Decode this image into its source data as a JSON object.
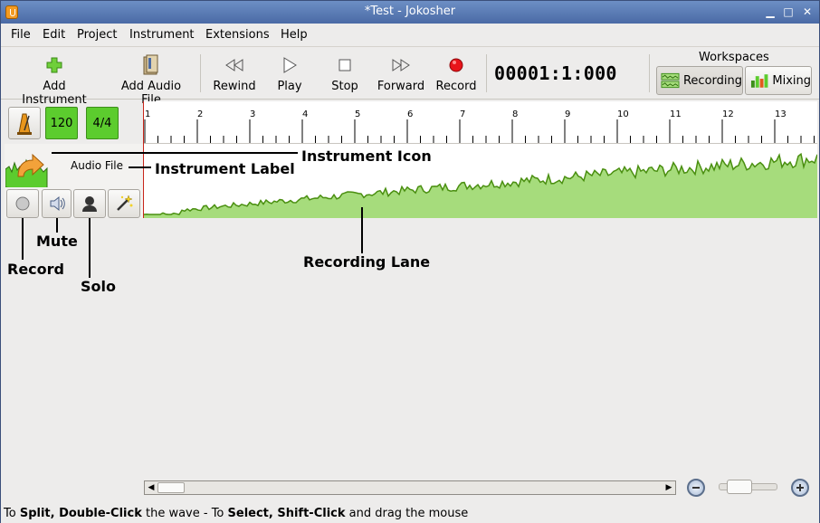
{
  "window": {
    "title": "*Test - Jokosher",
    "min_label": "▁",
    "max_label": "□",
    "close_label": "✕"
  },
  "menu": [
    "File",
    "Edit",
    "Project",
    "Instrument",
    "Extensions",
    "Help"
  ],
  "toolbar": {
    "add_instrument": "Add Instrument",
    "add_audio_file": "Add Audio File",
    "rewind": "Rewind",
    "play": "Play",
    "stop": "Stop",
    "forward": "Forward",
    "record": "Record",
    "timecode": "00001:1:000"
  },
  "workspaces": {
    "title": "Workspaces",
    "recording": "Recording",
    "mixing": "Mixing"
  },
  "header": {
    "bpm": "120",
    "time_signature": "4/4"
  },
  "ruler": {
    "labels": [
      "1",
      "2",
      "3",
      "4",
      "5",
      "6",
      "7",
      "8",
      "9",
      "10",
      "11",
      "12",
      "13"
    ]
  },
  "track": {
    "label": "Audio File"
  },
  "annotations": {
    "instrument_icon": "Instrument Icon",
    "instrument_label": "Instrument Label",
    "mute": "Mute",
    "record": "Record",
    "solo": "Solo",
    "recording_lane": "Recording Lane"
  },
  "status": {
    "p1": "To ",
    "b1": "Split, Double-Click",
    "p2": " the wave - To ",
    "b2": "Select, Shift-Click",
    "p3": " and drag the mouse"
  },
  "colors": {
    "accent_green": "#5ccc2e",
    "wave_fill": "#a6dc7c",
    "wave_line": "#4a8f10",
    "playhead": "#c8261b",
    "titlebar": "#5a7bb5"
  },
  "icons": {
    "add": "plus-icon",
    "audio": "audio-file-icon",
    "rewind": "rewind-icon",
    "play": "play-icon",
    "stop": "stop-icon",
    "forward": "forward-icon",
    "record": "record-icon"
  }
}
